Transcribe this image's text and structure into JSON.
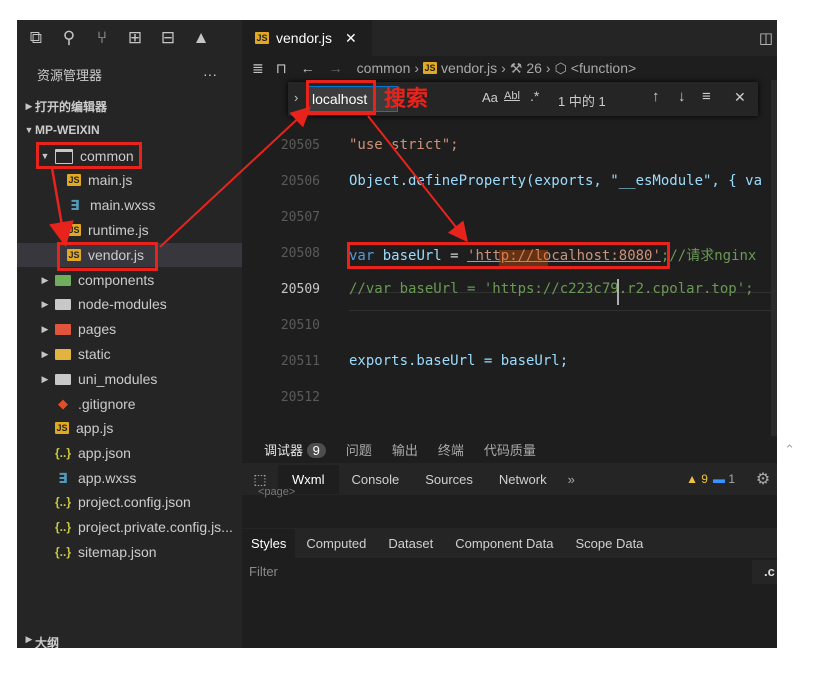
{
  "tab": {
    "icon": "JS",
    "name": "vendor.js",
    "close": "✕"
  },
  "breadcrumb": [
    "common",
    "vendor.js",
    "26",
    "<function>"
  ],
  "sidebar": {
    "title": "资源管理器",
    "more": "···",
    "sections": {
      "open_editors": "打开的编辑器",
      "workspace": "MP-WEIXIN",
      "outline": "大纲"
    },
    "items": [
      {
        "label": "common"
      },
      {
        "label": "main.js"
      },
      {
        "label": "main.wxss"
      },
      {
        "label": "runtime.js"
      },
      {
        "label": "vendor.js"
      },
      {
        "label": "components"
      },
      {
        "label": "node-modules"
      },
      {
        "label": "pages"
      },
      {
        "label": "static"
      },
      {
        "label": "uni_modules"
      },
      {
        "label": ".gitignore"
      },
      {
        "label": "app.js"
      },
      {
        "label": "app.json"
      },
      {
        "label": "app.wxss"
      },
      {
        "label": "project.config.json"
      },
      {
        "label": "project.private.config.js..."
      },
      {
        "label": "sitemap.json"
      }
    ]
  },
  "find": {
    "query": "localhost",
    "aa": "Aa",
    "ab": "Abl",
    "regex": ".*",
    "result": "1 中的 1"
  },
  "annotation": {
    "search": "搜索"
  },
  "code": {
    "lines": [
      "20505",
      "20506",
      "20507",
      "20508",
      "20509",
      "20510",
      "20511",
      "20512"
    ],
    "l1": "\"use strict\";",
    "l2a": "Object",
    ".l2b": ".",
    "l2": "Object.defineProperty(exports, \"__esModule\", { va",
    "l4_kw": "var",
    "l4_id": "baseUrl",
    "l4_url": "'http://localhost:8080'",
    "l4_cm": ";//请求nginx",
    "l5": "//var baseUrl = 'https://c223c79.r2.cpolar.top';",
    "l7": "exports.baseUrl = baseUrl;"
  },
  "devtools": {
    "top_tabs": [
      "调试器",
      "问题",
      "输出",
      "终端",
      "代码质量"
    ],
    "badge": "9",
    "tool_tabs": [
      "Wxml",
      "Console",
      "Sources",
      "Network"
    ],
    "more": "»",
    "warn": "▲ 9",
    "info": "1",
    "sub_tabs": [
      "Styles",
      "Computed",
      "Dataset",
      "Component Data",
      "Scope Data"
    ],
    "filter": "Filter",
    "page_tag": "<page>",
    "dot": ".c"
  },
  "colors": {
    "annotation": "#e8231c",
    "accent": "#0078d4"
  }
}
